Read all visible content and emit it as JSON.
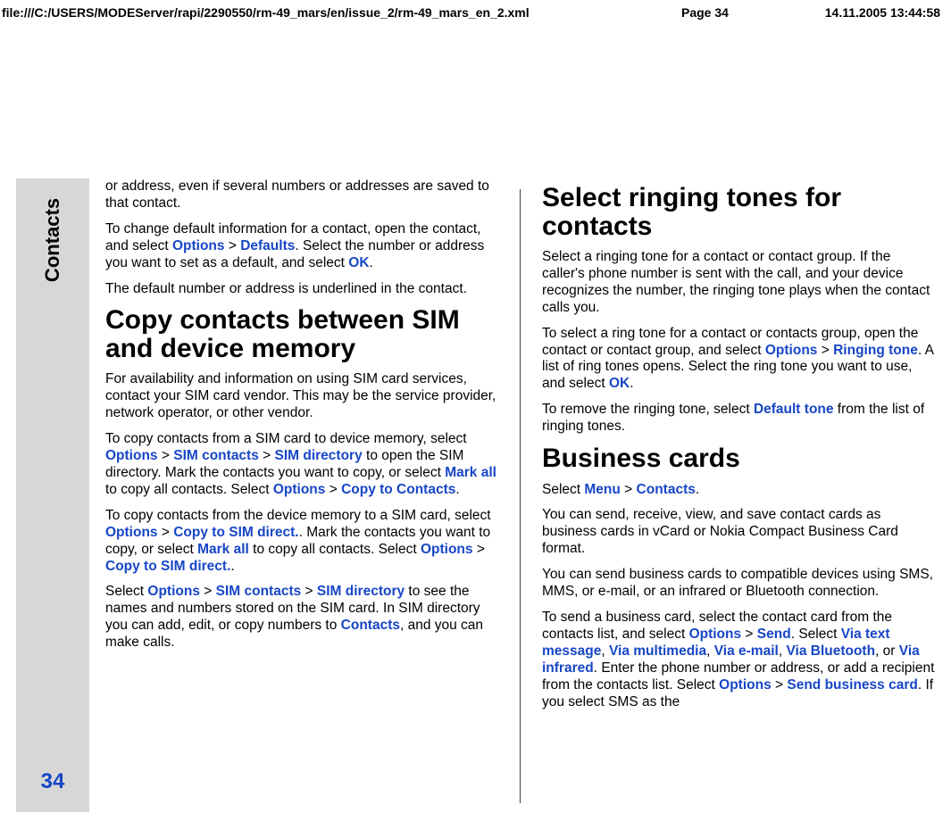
{
  "header": {
    "url": "file:///C:/USERS/MODEServer/rapi/2290550/rm-49_mars/en/issue_2/rm-49_mars_en_2.xml",
    "page": "Page 34",
    "date": "14.11.2005 13:44:58"
  },
  "sidebar": {
    "label": "Contacts",
    "pagenum": "34"
  },
  "col1": {
    "p1": "or address, even if several numbers or addresses are saved to that contact.",
    "p2a": "To change default information for a contact, open the contact, and select ",
    "p2_opt": "Options",
    "p2_gt1": " > ",
    "p2_def": "Defaults",
    "p2b": ". Select the number or address you want to set as a default, and select ",
    "p2_ok": "OK",
    "p2c": ".",
    "p3": "The default number or address is underlined in the contact.",
    "h1": "Copy contacts between SIM and device memory",
    "p4": "For availability and information on using SIM card services, contact your SIM card vendor. This may be the service provider, network operator, or other vendor.",
    "p5a": "To copy contacts from a SIM card to device memory, select ",
    "p5_opt": "Options",
    "p5_gt1": " > ",
    "p5_simc": "SIM contacts",
    "p5_gt2": " > ",
    "p5_simd": "SIM directory",
    "p5b": " to open the SIM directory. Mark the contacts you want to copy, or select ",
    "p5_mark": "Mark all",
    "p5c": " to copy all contacts. Select ",
    "p5_opt2": "Options",
    "p5_gt3": " > ",
    "p5_copy": "Copy to Contacts",
    "p5d": ".",
    "p6a": "To copy contacts from the device memory to a SIM card, select ",
    "p6_opt": "Options",
    "p6_gt1": " > ",
    "p6_copy": "Copy to SIM direct.",
    "p6b": ". Mark the contacts you want to copy, or select ",
    "p6_mark": "Mark all",
    "p6c": " to copy all contacts. Select ",
    "p6_opt2": "Options",
    "p6_gt2": " > ",
    "p6_copy2": "Copy to SIM direct.",
    "p6d": ".",
    "p7a": "Select ",
    "p7_opt": "Options",
    "p7_gt1": " > ",
    "p7_simc": "SIM contacts",
    "p7_gt2": " > ",
    "p7_simd": "SIM directory",
    "p7b": " to see the names and numbers stored on the SIM card. In SIM directory you can add, edit, or copy numbers to ",
    "p7_cont": "Contacts",
    "p7c": ", and you can make calls."
  },
  "col2": {
    "h1": "Select ringing tones for contacts",
    "p1": "Select a ringing tone for a contact or contact group. If the caller's phone number is sent with the call, and your device recognizes the number, the ringing tone plays when the contact calls you.",
    "p2a": "To select a ring tone for a contact or contacts group, open the contact or contact group, and select ",
    "p2_opt": "Options",
    "p2_gt": " > ",
    "p2_ring": "Ringing tone",
    "p2b": ". A list of ring tones opens. Select the ring tone you want to use, and select ",
    "p2_ok": "OK",
    "p2c": ".",
    "p3a": "To remove the ringing tone, select ",
    "p3_def": "Default tone",
    "p3b": " from the list of ringing tones.",
    "h2": "Business cards",
    "p4a": "Select ",
    "p4_menu": "Menu",
    "p4_gt": " > ",
    "p4_cont": "Contacts",
    "p4b": ".",
    "p5": "You can send, receive, view, and save contact cards as business cards in vCard or Nokia Compact Business Card format.",
    "p6": "You can send business cards to compatible devices using SMS, MMS, or e-mail, or an infrared or Bluetooth connection.",
    "p7a": "To send a business card, select the contact card from the contacts list, and select ",
    "p7_opt": "Options",
    "p7_gt1": " > ",
    "p7_send": "Send",
    "p7b": ". Select ",
    "p7_via1": "Via text message",
    "p7c": ", ",
    "p7_via2": "Via multimedia",
    "p7d": ", ",
    "p7_via3": "Via e-mail",
    "p7e": ", ",
    "p7_via4": "Via Bluetooth",
    "p7f": ", or ",
    "p7_via5": "Via infrared",
    "p7g": ". Enter the phone number or address, or add a recipient from the contacts list. Select ",
    "p7_opt2": "Options",
    "p7_gt2": " > ",
    "p7_sbc": "Send business card",
    "p7h": ". If you select SMS as the"
  }
}
